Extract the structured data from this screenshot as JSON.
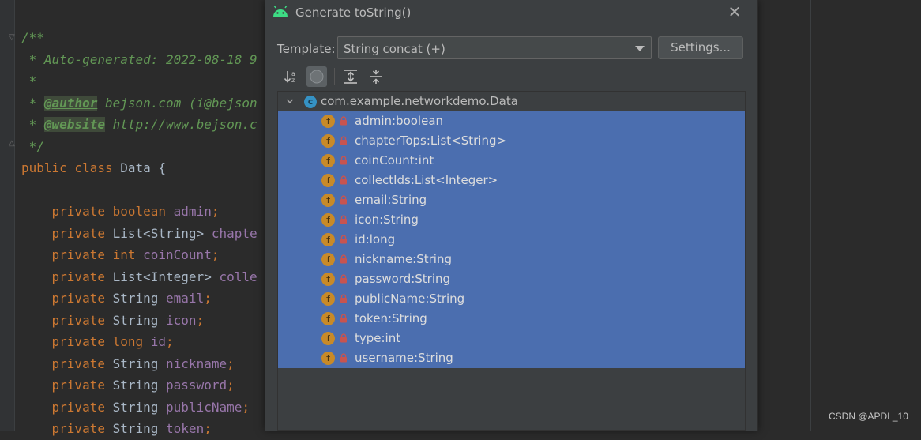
{
  "editor": {
    "lines": [
      [
        {
          "t": "/**",
          "c": "doc"
        }
      ],
      [
        {
          "t": " * Auto-generated: 2022-08-18 9",
          "c": "doc"
        }
      ],
      [
        {
          "t": " *",
          "c": "doc"
        }
      ],
      [
        {
          "t": " * ",
          "c": "doc"
        },
        {
          "t": "@author",
          "c": "tag"
        },
        {
          "t": " bejson.com (i@bejson",
          "c": "doc"
        }
      ],
      [
        {
          "t": " * ",
          "c": "doc"
        },
        {
          "t": "@website",
          "c": "tag"
        },
        {
          "t": " http://www.bejson.c",
          "c": "doc"
        }
      ],
      [
        {
          "t": " */",
          "c": "doc"
        }
      ],
      [
        {
          "t": "public class ",
          "c": "kw"
        },
        {
          "t": "Data {",
          "c": "pl"
        }
      ],
      [],
      [
        {
          "t": "    private boolean ",
          "c": "kw"
        },
        {
          "t": "admin",
          "c": "fld"
        },
        {
          "t": ";",
          "c": "kw"
        }
      ],
      [
        {
          "t": "    private ",
          "c": "kw"
        },
        {
          "t": "List<String> ",
          "c": "pl"
        },
        {
          "t": "chapte",
          "c": "fld"
        }
      ],
      [
        {
          "t": "    private int ",
          "c": "kw"
        },
        {
          "t": "coinCount",
          "c": "fld"
        },
        {
          "t": ";",
          "c": "kw"
        }
      ],
      [
        {
          "t": "    private ",
          "c": "kw"
        },
        {
          "t": "List<Integer> ",
          "c": "pl"
        },
        {
          "t": "colle",
          "c": "fld"
        }
      ],
      [
        {
          "t": "    private ",
          "c": "kw"
        },
        {
          "t": "String ",
          "c": "pl"
        },
        {
          "t": "email",
          "c": "fld"
        },
        {
          "t": ";",
          "c": "kw"
        }
      ],
      [
        {
          "t": "    private ",
          "c": "kw"
        },
        {
          "t": "String ",
          "c": "pl"
        },
        {
          "t": "icon",
          "c": "fld"
        },
        {
          "t": ";",
          "c": "kw"
        }
      ],
      [
        {
          "t": "    private long ",
          "c": "kw"
        },
        {
          "t": "id",
          "c": "fld"
        },
        {
          "t": ";",
          "c": "kw"
        }
      ],
      [
        {
          "t": "    private ",
          "c": "kw"
        },
        {
          "t": "String ",
          "c": "pl"
        },
        {
          "t": "nickname",
          "c": "fld"
        },
        {
          "t": ";",
          "c": "kw"
        }
      ],
      [
        {
          "t": "    private ",
          "c": "kw"
        },
        {
          "t": "String ",
          "c": "pl"
        },
        {
          "t": "password",
          "c": "fld"
        },
        {
          "t": ";",
          "c": "kw"
        }
      ],
      [
        {
          "t": "    private ",
          "c": "kw"
        },
        {
          "t": "String ",
          "c": "pl"
        },
        {
          "t": "publicName",
          "c": "fld"
        },
        {
          "t": ";",
          "c": "kw"
        }
      ],
      [
        {
          "t": "    private ",
          "c": "kw"
        },
        {
          "t": "String ",
          "c": "pl"
        },
        {
          "t": "token",
          "c": "fld"
        },
        {
          "t": ";",
          "c": "kw"
        }
      ]
    ]
  },
  "dialog": {
    "title": "Generate toString()",
    "template_label": "Template:",
    "template_value": "String concat (+)",
    "settings_label": "Settings...",
    "tree": {
      "root": "com.example.networkdemo.Data",
      "class_icon_letter": "c",
      "field_icon_letter": "f",
      "items": [
        "admin:boolean",
        "chapterTops:List<String>",
        "coinCount:int",
        "collectIds:List<Integer>",
        "email:String",
        "icon:String",
        "id:long",
        "nickname:String",
        "password:String",
        "publicName:String",
        "token:String",
        "type:int",
        "username:String"
      ]
    }
  },
  "watermark": "CSDN @APDL_10",
  "colors": {
    "selection": "#4b6eaf",
    "dialog_bg": "#3c3f41",
    "editor_bg": "#2b2b2b",
    "keyword": "#cc7832",
    "field": "#9876aa",
    "doc_comment": "#629755"
  }
}
